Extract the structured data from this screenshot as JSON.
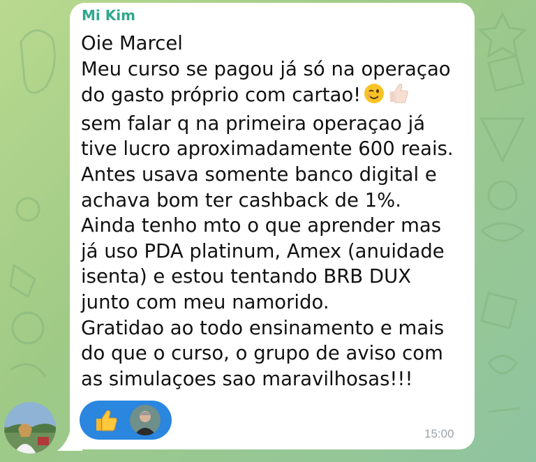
{
  "chat": {
    "sender_name": "Mi Kim",
    "message_lines": [
      "Oie Marcel",
      "Meu curso se pagou já só na operaçao",
      "do gasto próprio com cartao!",
      "sem falar q na primeira operaçao já",
      "tive lucro aproximadamente 600 reais.",
      "Antes usava somente banco digital e",
      "achava bom ter cashback de 1%.",
      "Ainda tenho mto o que aprender mas",
      "já uso PDA platinum, Amex (anuidade",
      "isenta) e estou tentando BRB DUX",
      "junto com meu namorido.",
      "Gratidao ao todo ensinamento e mais",
      "do que o curso, o grupo de aviso com",
      "as simulaçoes sao maravilhosas!!!"
    ],
    "inline_emojis": [
      "wink-emoji",
      "thumbs-up-emoji"
    ],
    "timestamp": "15:00",
    "reaction": {
      "emoji": "thumbs-up",
      "color": "#2a86df"
    }
  },
  "colors": {
    "sender_name": "#2fa88c",
    "bubble": "#ffffff",
    "timestamp": "#9aa3ab"
  }
}
